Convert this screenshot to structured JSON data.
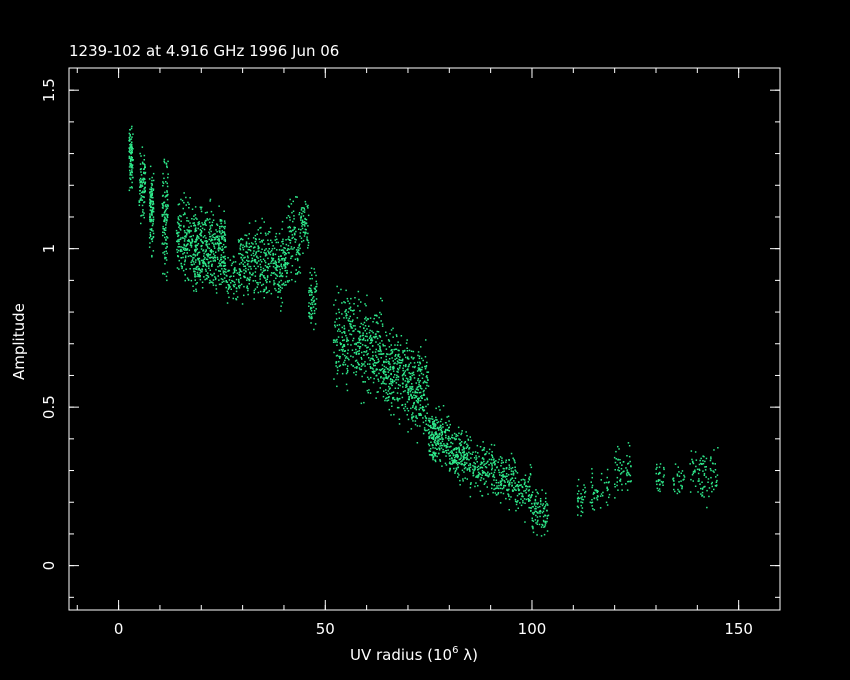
{
  "chart_data": {
    "type": "scatter",
    "title": "1239-102 at 4.916 GHz 1996 Jun 06",
    "xlabel_main": "UV radius  (10",
    "xlabel_exp": "6",
    "xlabel_tail": " λ)",
    "ylabel": "Amplitude",
    "xlim": [
      -12,
      160
    ],
    "ylim": [
      -0.14,
      1.57
    ],
    "x_ticks": [
      0,
      50,
      100,
      150
    ],
    "x_tick_labels": [
      "0",
      "50",
      "100",
      "150"
    ],
    "y_ticks": [
      0,
      0.5,
      1,
      1.5
    ],
    "y_tick_labels": [
      "0",
      "0.5",
      "1",
      "1.5"
    ],
    "x_minor_step": 10,
    "y_minor_step": 0.1,
    "grid": false,
    "point_color": "#2ee88a",
    "background": "#000000",
    "axis_color": "#ffffff",
    "series": [
      {
        "clusters": [
          {
            "x": [
              2.5,
              3.5
            ],
            "y": [
              1.15,
              1.42
            ],
            "n": 90
          },
          {
            "x": [
              5,
              6.5
            ],
            "y": [
              1.05,
              1.35
            ],
            "n": 90
          },
          {
            "x": [
              7.5,
              8.5
            ],
            "y": [
              0.95,
              1.3
            ],
            "n": 110
          },
          {
            "x": [
              10.5,
              12
            ],
            "y": [
              0.85,
              1.37
            ],
            "n": 110
          },
          {
            "x": [
              14,
              18
            ],
            "y": [
              0.85,
              1.2
            ],
            "n": 160
          },
          {
            "x": [
              18,
              26
            ],
            "y": [
              0.8,
              1.18
            ],
            "n": 420
          },
          {
            "x": [
              26,
              29
            ],
            "y": [
              0.8,
              1.0
            ],
            "n": 60
          },
          {
            "x": [
              29,
              41
            ],
            "y": [
              0.78,
              1.13
            ],
            "n": 420
          },
          {
            "x": [
              41,
              44
            ],
            "y": [
              0.85,
              1.2
            ],
            "n": 90
          },
          {
            "x": [
              44,
              46
            ],
            "y": [
              0.95,
              1.2
            ],
            "n": 60
          },
          {
            "x": [
              46,
              48
            ],
            "y": [
              0.73,
              0.97
            ],
            "n": 70
          },
          {
            "x": [
              52,
              58
            ],
            "y": [
              0.5,
              0.95
            ],
            "n": 180
          },
          {
            "x": [
              58,
              64
            ],
            "y": [
              0.47,
              0.88
            ],
            "n": 220
          },
          {
            "x": [
              64,
              70
            ],
            "y": [
              0.42,
              0.8
            ],
            "n": 240
          },
          {
            "x": [
              70,
              75
            ],
            "y": [
              0.35,
              0.75
            ],
            "n": 220
          },
          {
            "x": [
              75,
              80
            ],
            "y": [
              0.28,
              0.52
            ],
            "n": 220
          },
          {
            "x": [
              80,
              85
            ],
            "y": [
              0.24,
              0.46
            ],
            "n": 180
          },
          {
            "x": [
              85,
              91
            ],
            "y": [
              0.2,
              0.42
            ],
            "n": 150
          },
          {
            "x": [
              91,
              96
            ],
            "y": [
              0.17,
              0.38
            ],
            "n": 130
          },
          {
            "x": [
              96,
              100
            ],
            "y": [
              0.13,
              0.33
            ],
            "n": 90
          },
          {
            "x": [
              100,
              104
            ],
            "y": [
              0.06,
              0.27
            ],
            "n": 90
          },
          {
            "x": [
              111,
              113
            ],
            "y": [
              0.12,
              0.3
            ],
            "n": 30
          },
          {
            "x": [
              114,
              119
            ],
            "y": [
              0.15,
              0.32
            ],
            "n": 50
          },
          {
            "x": [
              120,
              124
            ],
            "y": [
              0.18,
              0.41
            ],
            "n": 60
          },
          {
            "x": [
              130,
              132
            ],
            "y": [
              0.2,
              0.36
            ],
            "n": 30
          },
          {
            "x": [
              134,
              137
            ],
            "y": [
              0.2,
              0.34
            ],
            "n": 30
          },
          {
            "x": [
              138,
              145
            ],
            "y": [
              0.16,
              0.43
            ],
            "n": 90
          }
        ]
      }
    ]
  }
}
